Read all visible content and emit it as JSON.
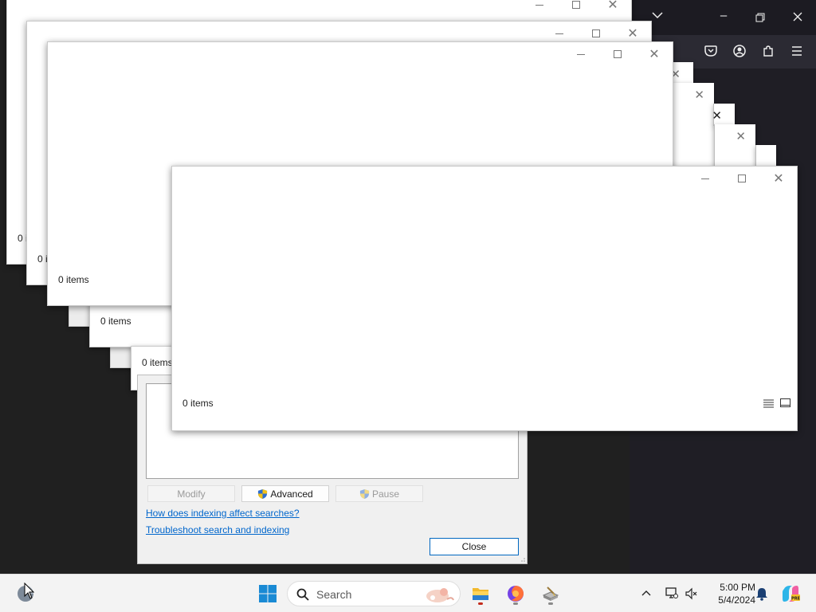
{
  "windows": {
    "status_text": "0 items",
    "partial_status": "0 i"
  },
  "dialog": {
    "modify_label": "Modify",
    "advanced_label": "Advanced",
    "pause_label": "Pause",
    "link_indexing": "How does indexing affect searches?",
    "link_troubleshoot": "Troubleshoot search and indexing",
    "close_label": "Close"
  },
  "taskbar": {
    "search_placeholder": "Search",
    "time": "5:00 PM",
    "date": "5/4/2024"
  },
  "colors": {
    "accent": "#0067c0",
    "link": "#0066cc",
    "taskbar": "#f3f3f3",
    "desktop": "#202020"
  },
  "icons": {
    "window_minimize": "minimize-icon",
    "window_maximize": "maximize-icon",
    "window_close": "close-icon",
    "start": "windows-start-icon",
    "search": "search-icon",
    "file_explorer": "folder-icon",
    "firefox": "firefox-icon",
    "tray_chevron": "chevron-up-icon",
    "network": "network-icon",
    "volume": "volume-muted-icon",
    "bell": "bell-icon",
    "copilot": "copilot-icon"
  }
}
